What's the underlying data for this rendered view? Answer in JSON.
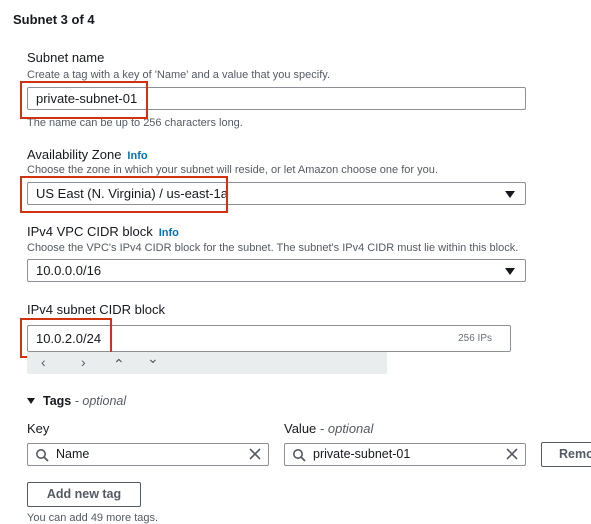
{
  "section": {
    "title": "Subnet 3 of 4"
  },
  "subnet_name": {
    "label": "Subnet name",
    "description": "Create a tag with a key of 'Name' and a value that you specify.",
    "value": "private-subnet-01",
    "hint": "The name can be up to 256 characters long."
  },
  "az": {
    "label": "Availability Zone",
    "info": "Info",
    "description": "Choose the zone in which your subnet will reside, or let Amazon choose one for you.",
    "value": "US East (N. Virginia) / us-east-1a"
  },
  "vpc_cidr": {
    "label": "IPv4 VPC CIDR block",
    "info": "Info",
    "description": "Choose the VPC's IPv4 CIDR block for the subnet. The subnet's IPv4 CIDR must lie within this block.",
    "value": "10.0.0.0/16"
  },
  "subnet_cidr": {
    "label": "IPv4 subnet CIDR block",
    "value": "10.0.2.0/24",
    "suffix": "256 IPs",
    "nav": {
      "left": "‹",
      "right": "›",
      "up": "⌃",
      "down": "⌄"
    }
  },
  "tags": {
    "header": "Tags",
    "header_optional": "- optional",
    "key_label": "Key",
    "value_label": "Value",
    "value_optional": "- optional",
    "key_value": "Name",
    "value_value": "private-subnet-01",
    "remove_label": "Remo",
    "add_label": "Add new tag",
    "footer": "You can add 49 more tags."
  },
  "colors": {
    "highlight": "#d13212",
    "link": "#0073bb"
  }
}
